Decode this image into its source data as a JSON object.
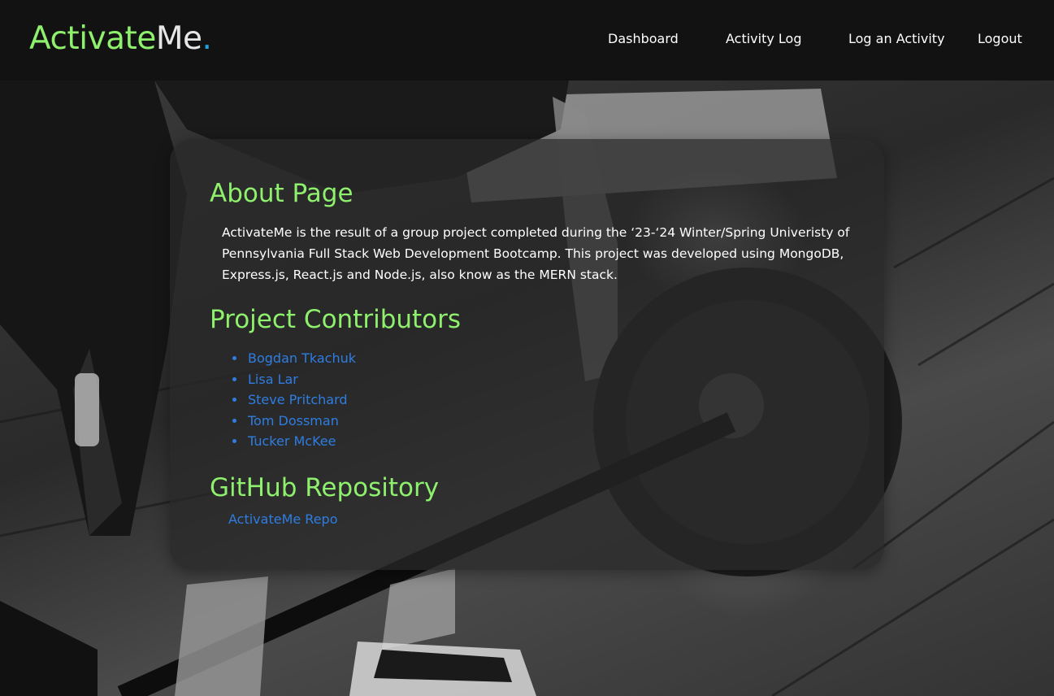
{
  "header": {
    "logo_part1": "Activate",
    "logo_part2": "Me",
    "logo_part3": ".",
    "nav": [
      "Dashboard",
      "Activity Log",
      "Log an Activity",
      "Logout"
    ]
  },
  "about": {
    "title": "About Page",
    "text": "ActivateMe is the result of a group project completed during the ‘23-‘24 Winter/Spring Univeristy of Pennsylvania Full Stack Web Development Bootcamp. This project was developed using MongoDB, Express.js, React.js and Node.js, also know as the MERN stack."
  },
  "contributors": {
    "title": "Project Contributors",
    "items": [
      "Bogdan Tkachuk",
      "Lisa Lar",
      "Steve Pritchard",
      "Tom Dossman",
      "Tucker McKee"
    ]
  },
  "repo": {
    "title": "GitHub Repository",
    "link_label": "ActivateMe Repo"
  },
  "colors": {
    "accent_green": "#8ef06d",
    "link_blue": "#2f7de1",
    "header_bg": "#121212"
  }
}
